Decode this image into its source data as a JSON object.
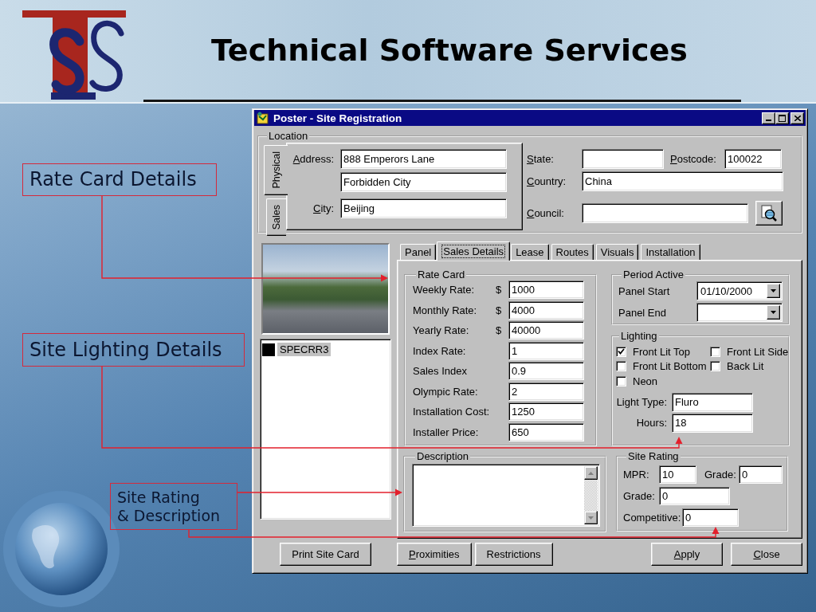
{
  "slide": {
    "title": "Technical Software Services"
  },
  "callouts": [
    {
      "text": "Rate Card Details"
    },
    {
      "text": "Site Lighting Details"
    },
    {
      "text": "Site Rating\n& Description"
    }
  ],
  "window": {
    "title": "Poster - Site Registration"
  },
  "location": {
    "label": "Location",
    "side_tabs": [
      {
        "label": "Physical",
        "selected": true
      },
      {
        "label": "Sales",
        "selected": false
      }
    ],
    "address": {
      "label": "Address:",
      "mnemonic": true,
      "lines": [
        "888 Emperors Lane",
        "Forbidden City"
      ]
    },
    "city": {
      "label": "City:",
      "mnemonic": true,
      "value": "Beijing"
    },
    "state": {
      "label": "State:",
      "mnemonic": true
    },
    "postcode": {
      "label": "Postcode:",
      "mnemonic": true,
      "value": "100022"
    },
    "country": {
      "label": "Country:",
      "mnemonic": true,
      "value": "China"
    },
    "council": {
      "label": "Council:",
      "mnemonic": true
    }
  },
  "site_list": {
    "items": [
      {
        "label": "SPECRR3",
        "selected": true
      }
    ]
  },
  "tabs": [
    {
      "label": "Panel",
      "selected": false
    },
    {
      "label": "Sales Details",
      "selected": true
    },
    {
      "label": "Lease",
      "selected": false
    },
    {
      "label": "Routes",
      "selected": false
    },
    {
      "label": "Visuals",
      "selected": false
    },
    {
      "label": "Installation",
      "selected": false
    }
  ],
  "rate_card": {
    "label": "Rate Card",
    "rows": [
      {
        "label": "Weekly Rate:",
        "currency": "$",
        "value": "1000"
      },
      {
        "label": "Monthly Rate:",
        "currency": "$",
        "value": "4000"
      },
      {
        "label": "Yearly Rate:",
        "currency": "$",
        "value": "40000"
      },
      {
        "label": "Index Rate:",
        "value": "1"
      },
      {
        "label": "Sales Index",
        "value": "0.9"
      },
      {
        "label": "Olympic Rate:",
        "value": "2"
      },
      {
        "label": "Installation Cost:",
        "value": "1250"
      },
      {
        "label": "Installer Price:",
        "value": "650"
      }
    ]
  },
  "period_active": {
    "label": "Period Active",
    "rows": [
      {
        "label": "Panel Start",
        "value": "01/10/2000"
      },
      {
        "label": "Panel End"
      }
    ]
  },
  "lighting": {
    "label": "Lighting",
    "checkboxes": [
      {
        "label": "Front Lit Top",
        "checked": true
      },
      {
        "label": "Front Lit Side",
        "checked": false
      },
      {
        "label": "Front Lit Bottom",
        "checked": false
      },
      {
        "label": "Back Lit",
        "checked": false
      },
      {
        "label": "Neon",
        "checked": false
      }
    ],
    "light_type": {
      "label": "Light Type:",
      "value": "Fluro"
    },
    "hours": {
      "label": "Hours:",
      "value": "18"
    }
  },
  "description": {
    "label": "Description"
  },
  "site_rating": {
    "label": "Site Rating",
    "mpr": {
      "label": "MPR:",
      "value": "10"
    },
    "grade_1": {
      "label": "Grade:",
      "value": "0"
    },
    "grade_2": {
      "label": "Grade:",
      "value": "0"
    },
    "competitive": {
      "label": "Competitive:",
      "value": "0"
    }
  },
  "footer": {
    "left": [
      {
        "label": "Print Site Card"
      }
    ],
    "middle": [
      {
        "label": "Proximities",
        "mnemonic": true
      },
      {
        "label": "Restrictions"
      }
    ],
    "right": [
      {
        "label": "Apply",
        "mnemonic": true
      },
      {
        "label": "Close",
        "mnemonic": true
      }
    ]
  }
}
